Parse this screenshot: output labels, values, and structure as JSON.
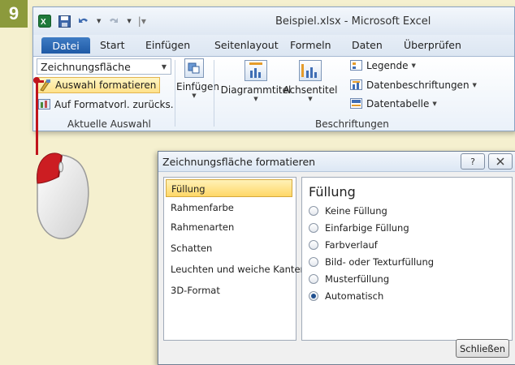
{
  "step_number": "9",
  "excel": {
    "title": "Beispiel.xlsx - Microsoft Excel",
    "qat_icons": [
      "excel-logo-icon",
      "save-icon",
      "undo-icon",
      "redo-icon",
      "customize-qat-icon"
    ],
    "tabs": [
      "Datei",
      "Start",
      "Einfügen",
      "Seitenlayout",
      "Formeln",
      "Daten",
      "Überprüfen"
    ],
    "current_selection": {
      "dropdown_value": "Zeichnungsfläche",
      "format_button": "Auswahl formatieren",
      "reset_button": "Auf Formatvorl. zurücks.",
      "group_label": "Aktuelle Auswahl"
    },
    "insert_button": "Einfügen",
    "labels_group": {
      "chart_title": "Diagrammtitel",
      "axis_title": "Achsentitel",
      "legend": "Legende",
      "data_labels": "Datenbeschriftungen",
      "data_table": "Datentabelle",
      "group_label": "Beschriftungen"
    }
  },
  "dialog": {
    "title": "Zeichnungsfläche formatieren",
    "help_button": "?",
    "close_icon": "close-icon",
    "categories": [
      "Füllung",
      "Rahmenfarbe",
      "Rahmenarten",
      "Schatten",
      "Leuchten und weiche Kanten",
      "3D-Format"
    ],
    "selected_category": "Füllung",
    "panel_heading": "Füllung",
    "fill_options": [
      "Keine Füllung",
      "Einfarbige Füllung",
      "Farbverlauf",
      "Bild- oder Texturfüllung",
      "Musterfüllung",
      "Automatisch"
    ],
    "selected_fill": "Automatisch",
    "close_button": "Schließen"
  },
  "colors": {
    "background": "#f5f0cf",
    "step_badge": "#8c9a3c",
    "file_tab": "#2a67b3",
    "pointer_line": "#c0141c"
  }
}
